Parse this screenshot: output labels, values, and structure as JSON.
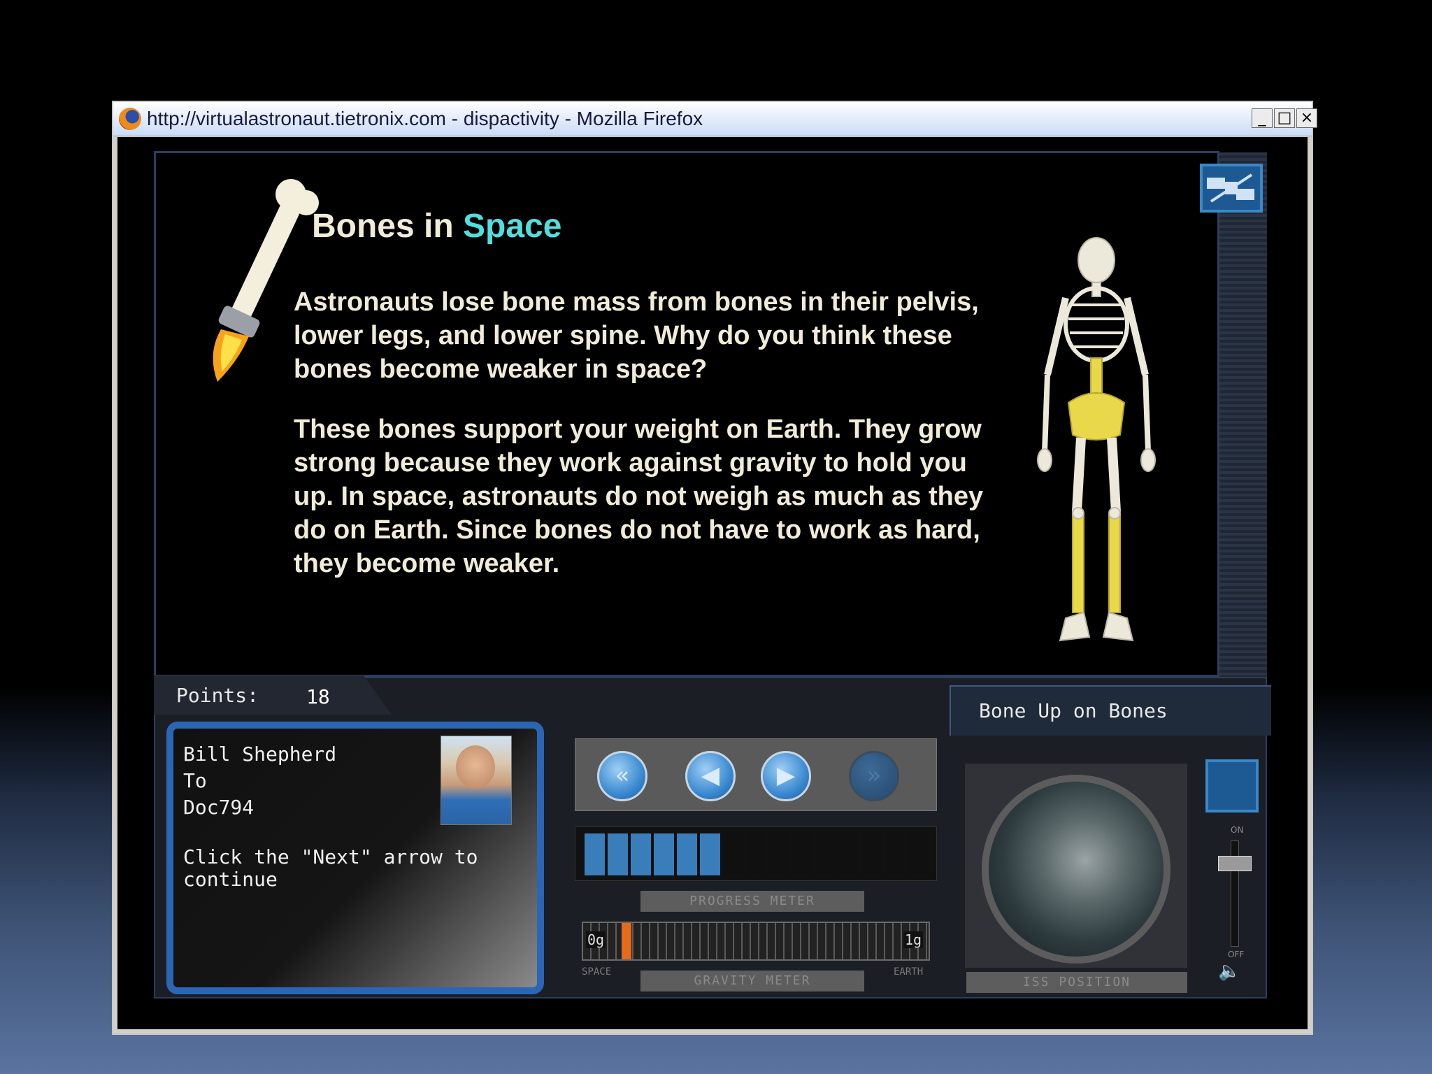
{
  "window": {
    "title": "http://virtualastronaut.tietronix.com - dispactivity - Mozilla Firefox",
    "minimize": "_",
    "maximize": "□",
    "close": "×"
  },
  "lesson": {
    "heading_prefix": "Bones in ",
    "heading_accent": "Space",
    "question": "Astronauts lose bone mass from bones in their pelvis, lower legs, and lower spine. Why do you think these bones become weaker in space?",
    "answer": "These bones support your weight on Earth. They grow strong because they work against gravity to hold you up. In space, astronauts do not weigh as much as they do on Earth. Since bones do not have to work as hard,  they become weaker.",
    "topic": "Bone Up on Bones"
  },
  "points": {
    "label": "Points:",
    "value": "18"
  },
  "message": {
    "from": "Bill Shepherd",
    "to_label": "To",
    "to": "Doc794",
    "instruction": "Click the \"Next\" arrow to continue"
  },
  "nav": {
    "first": "«",
    "prev": "◀",
    "next": "▶",
    "last": "»"
  },
  "progress_meter": {
    "caption": "PROGRESS METER",
    "cells_total": 15,
    "cells_filled": 6
  },
  "gravity_meter": {
    "caption": "GRAVITY METER",
    "min_label": "0g",
    "max_label": "1g",
    "left_end": "SPACE",
    "right_end": "EARTH",
    "level": 0.05
  },
  "iss_position": {
    "caption": "ISS POSITION"
  },
  "volume": {
    "on_label": "ON",
    "off_label": "OFF",
    "speaker_icon": "🔈"
  },
  "colors": {
    "accent": "#52dede",
    "frame": "#2a66b4",
    "text": "#f0ecd8",
    "bone_highlight": "#e8d84a"
  }
}
